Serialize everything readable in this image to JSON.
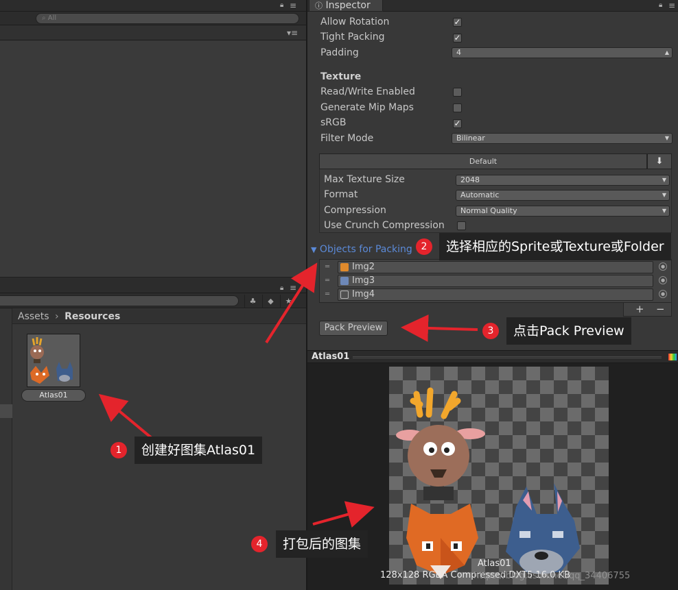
{
  "hierarchy": {
    "search_placeholder": "All"
  },
  "project": {
    "breadcrumb": [
      "Assets",
      "Resources"
    ],
    "asset_name": "Atlas01"
  },
  "inspector": {
    "tab_title": "Inspector",
    "settings": [
      {
        "label": "Allow Rotation",
        "checked": true
      },
      {
        "label": "Tight Packing",
        "checked": true
      },
      {
        "label": "Padding",
        "value": "4"
      }
    ],
    "texture_section": "Texture",
    "texture": [
      {
        "label": "Read/Write Enabled",
        "checked": false
      },
      {
        "label": "Generate Mip Maps",
        "checked": false
      },
      {
        "label": "sRGB",
        "checked": true
      },
      {
        "label": "Filter Mode",
        "value": "Bilinear"
      }
    ],
    "platform_tab": "Default",
    "platform": [
      {
        "label": "Max Texture Size",
        "value": "2048"
      },
      {
        "label": "Format",
        "value": "Automatic"
      },
      {
        "label": "Compression",
        "value": "Normal Quality"
      },
      {
        "label": "Use Crunch Compression",
        "checked": false
      }
    ],
    "objects_title": "Objects for Packing",
    "objects": [
      "Img2",
      "Img3",
      "Img4"
    ],
    "pack_preview_label": "Pack Preview"
  },
  "preview": {
    "title": "Atlas01",
    "name": "Atlas01",
    "info": "128x128 RGBA Compressed DXT5  16.0 KB"
  },
  "annotations": [
    {
      "num": "1",
      "text": "创建好图集Atlas01"
    },
    {
      "num": "2",
      "text": "选择相应的Sprite或Texture或Folder"
    },
    {
      "num": "3",
      "text": "点击Pack Preview"
    },
    {
      "num": "4",
      "text": "打包后的图集"
    }
  ],
  "watermark": "https://blog.csdn.net/qq_34406755",
  "colors": {
    "annotation_red": "#e4242c",
    "link_blue": "#5b8ad8",
    "callout_bg": "#232323"
  }
}
